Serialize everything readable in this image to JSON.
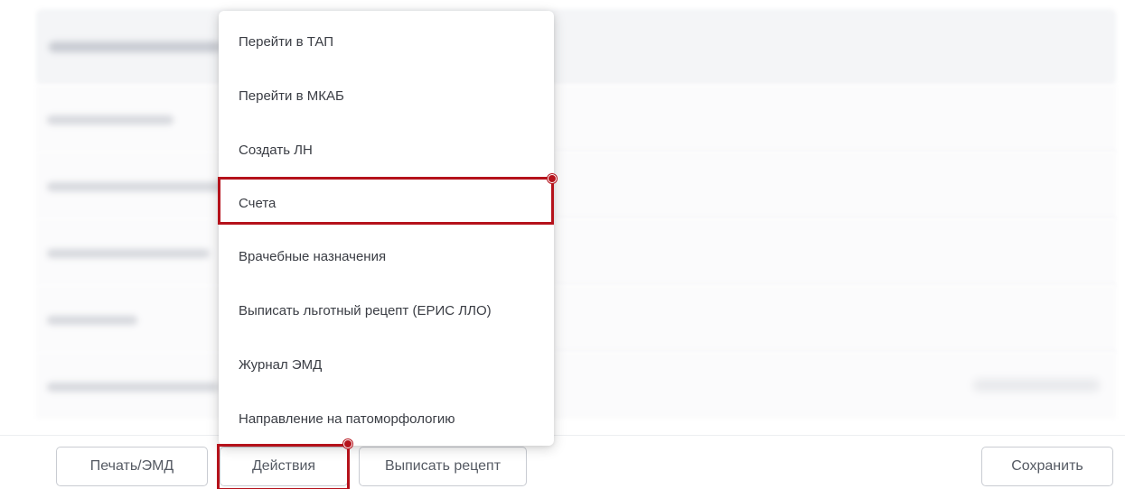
{
  "menu": {
    "items": [
      {
        "label": "Перейти в ТАП"
      },
      {
        "label": "Перейти в МКАБ"
      },
      {
        "label": "Создать ЛН"
      },
      {
        "label": "Счета"
      },
      {
        "label": "Врачебные назначения"
      },
      {
        "label": "Выписать льготный рецепт (ЕРИС ЛЛО)"
      },
      {
        "label": "Журнал ЭМД"
      },
      {
        "label": "Направление на патоморфологию"
      }
    ],
    "highlighted_item": "Счета"
  },
  "toolbar": {
    "print_label": "Печать/ЭМД",
    "actions_label": "Действия",
    "recipe_label": "Выписать рецепт",
    "save_label": "Сохранить"
  },
  "colors": {
    "highlight": "#b5121b",
    "button_border": "#c9ccd2",
    "button_text": "#555a63",
    "menu_text": "#3a3d44"
  }
}
